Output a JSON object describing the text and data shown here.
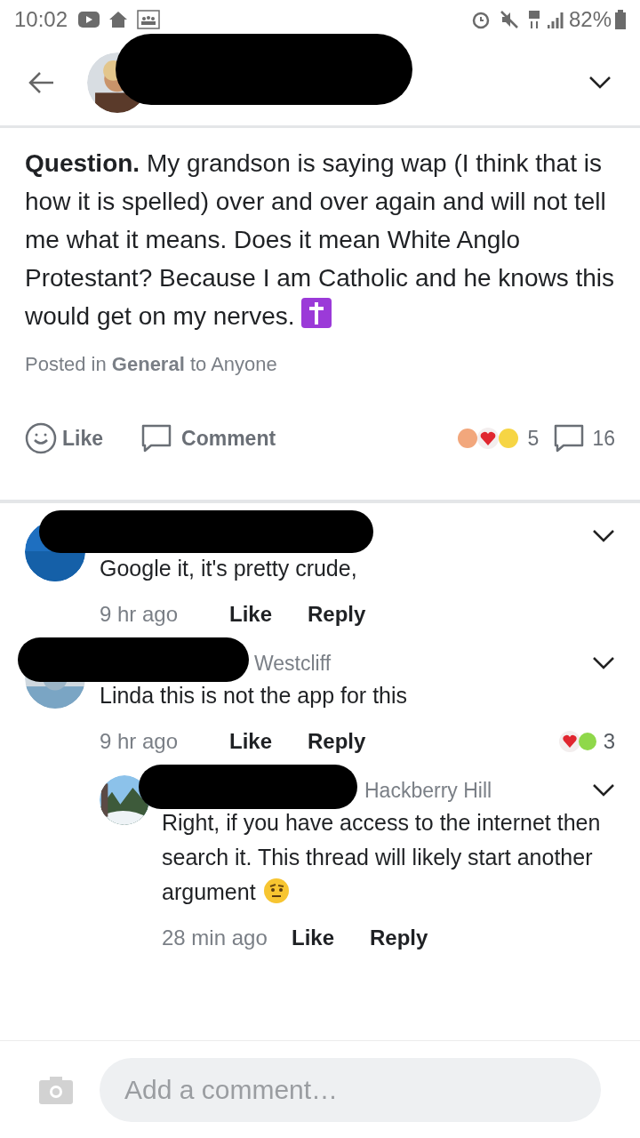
{
  "status_bar": {
    "time": "10:02",
    "battery": "82%"
  },
  "post": {
    "lead": "Question.",
    "body": "My grandson is saying wap (I think that is how it is spelled) over and over again and will not tell me what it means. Does it mean White Anglo Protestant? Because I am Catholic and he knows this would get on my nerves.",
    "posted": "Posted in **General** to Anyone"
  },
  "actions": {
    "like": "Like",
    "comment": "Comment",
    "reactions_count": "5",
    "comments_count": "16"
  },
  "comments": [
    {
      "text": "Google it, it's pretty crude,",
      "time": "9 hr ago",
      "like": "Like",
      "reply": "Reply"
    },
    {
      "neighborhood": "Westcliff",
      "text": "Linda this is not the app for this",
      "time": "9 hr ago",
      "like": "Like",
      "reply": "Reply",
      "reactions_count": "3",
      "children": [
        {
          "neighborhood": "Hackberry Hill",
          "text": "Right, if you have access to the internet then search it. This thread will likely start another argument",
          "time": "28 min ago",
          "like": "Like",
          "reply": "Reply"
        }
      ]
    }
  ],
  "composer": {
    "placeholder": "Add a comment…"
  }
}
